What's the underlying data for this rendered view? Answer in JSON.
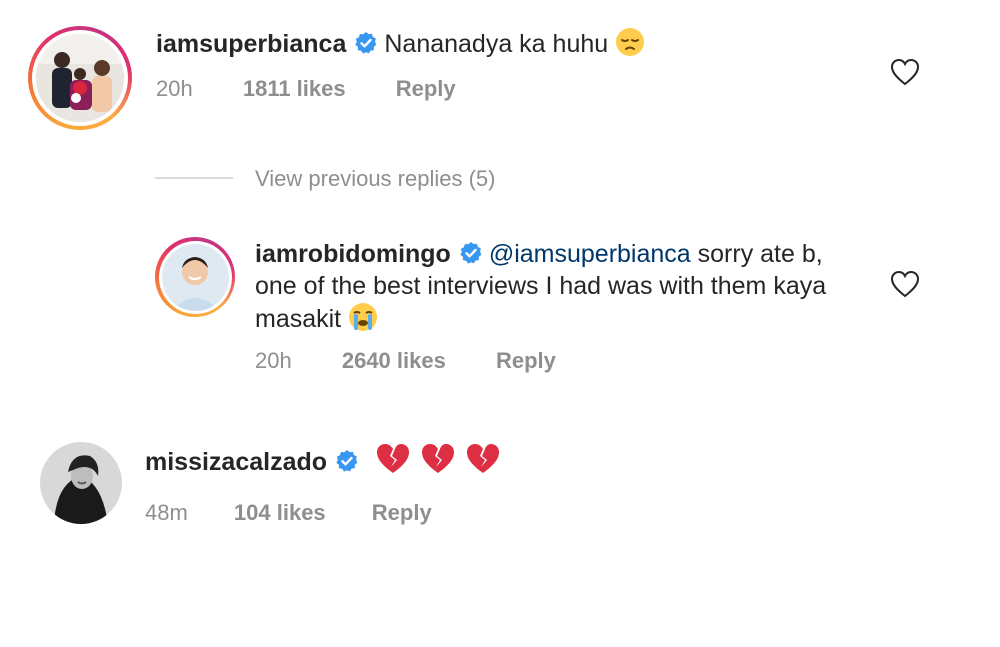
{
  "comments": [
    {
      "username": "iamsuperbianca",
      "text": "Nananadya ka huhu",
      "emoji": "pensive-face",
      "time": "20h",
      "likes": "1811 likes",
      "reply": "Reply"
    },
    {
      "username": "iamrobidomingo",
      "mention": "@iamsuperbianca",
      "text_line1": "sorry ate b,",
      "text_line2": "one of the best interviews I had was with them kaya",
      "text_line3": "masakit",
      "emoji": "loudly-crying-face",
      "time": "20h",
      "likes": "2640 likes",
      "reply": "Reply"
    },
    {
      "username": "missizacalzado",
      "emoji": "broken-heart x3",
      "time": "48m",
      "likes": "104 likes",
      "reply": "Reply"
    }
  ],
  "view_previous_replies": "View previous replies (5)",
  "colors": {
    "text": "#262626",
    "meta": "#8e8e8e",
    "mention": "#00376b",
    "verified": "#3897f0",
    "broken_heart": "#dd2e44"
  }
}
